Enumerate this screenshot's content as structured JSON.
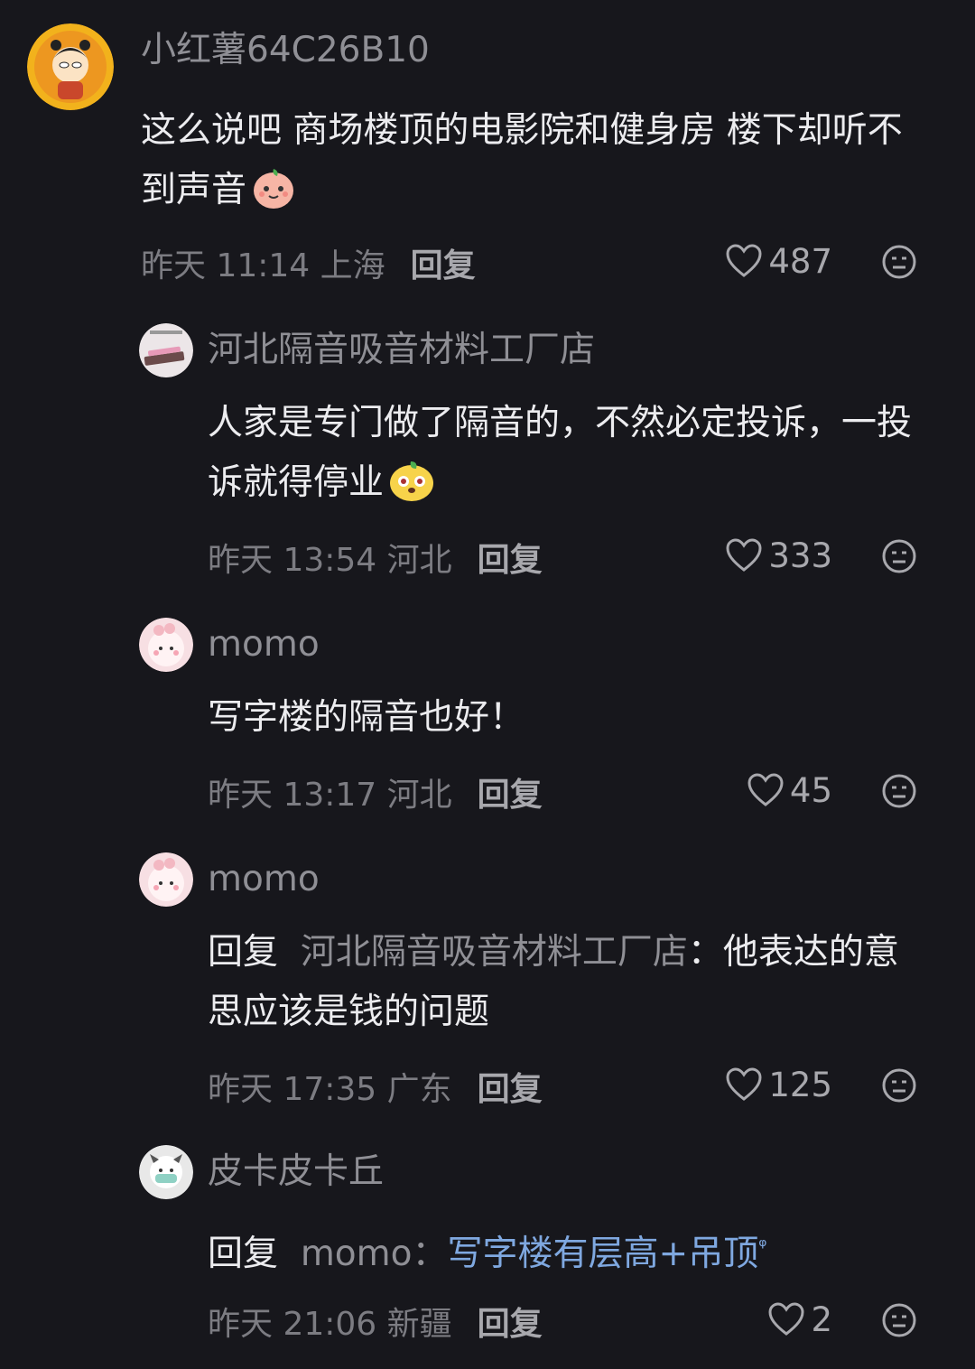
{
  "comments": [
    {
      "username": "小红薯64C26B10",
      "text": "这么说吧 商场楼顶的电影院和健身房 楼下却听不到声音",
      "emoji": "peach-face-emoji",
      "time": "昨天 11:14",
      "location": "上海",
      "reply_label": "回复",
      "likes": "487"
    },
    {
      "username": "河北隔音吸音材料工厂店",
      "text": "人家是专门做了隔音的，不然必定投诉，一投诉就得停业",
      "emoji": "yellow-dog-emoji",
      "time": "昨天 13:54",
      "location": "河北",
      "reply_label": "回复",
      "likes": "333"
    },
    {
      "username": "momo",
      "text": "写字楼的隔音也好！",
      "time": "昨天 13:17",
      "location": "河北",
      "reply_label": "回复",
      "likes": "45"
    },
    {
      "username": "momo",
      "reply_prefix": "回复",
      "mention": "河北隔音吸音材料工厂店",
      "text": "：他表达的意思应该是钱的问题",
      "time": "昨天 17:35",
      "location": "广东",
      "reply_label": "回复",
      "likes": "125"
    },
    {
      "username": "皮卡皮卡丘",
      "reply_prefix": "回复",
      "mention": "momo",
      "colon": "：",
      "text": "写字楼有层高+吊顶",
      "search_mark": "ᵠ",
      "time": "昨天 21:06",
      "location": "新疆",
      "reply_label": "回复",
      "likes": "2"
    }
  ],
  "icons": {
    "like": "heart-outline-icon",
    "dislike": "unhappy-face-icon",
    "search_link": "search-magnifier-icon"
  },
  "colors": {
    "background": "#17171c",
    "username": "#8f8f95",
    "text": "#ececef",
    "link": "#7fa8e0"
  }
}
